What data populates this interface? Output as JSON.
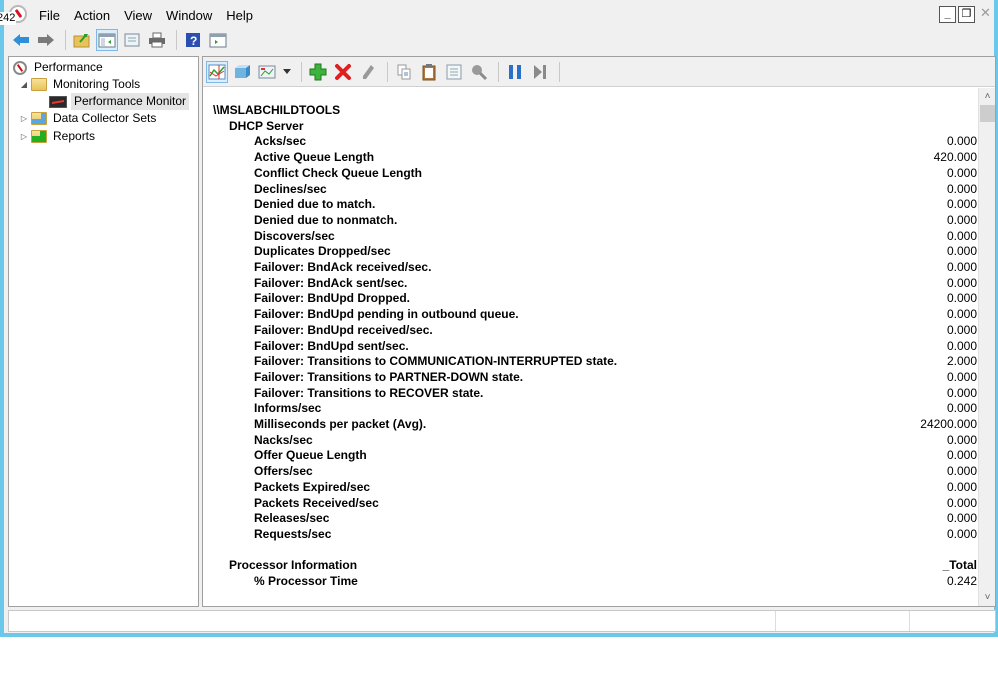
{
  "window": {
    "badge_text": "242",
    "menu": [
      "File",
      "Action",
      "View",
      "Window",
      "Help"
    ],
    "controls": {
      "minimize": "_",
      "restore": "❐",
      "close": "✕"
    }
  },
  "toolbar": {
    "buttons": [
      "back-icon",
      "forward-icon",
      "up-folder-icon",
      "show-hide-console-tree-icon",
      "properties-icon",
      "print-icon",
      "help-icon",
      "show-hide-action-pane-icon"
    ]
  },
  "tree": {
    "items": [
      {
        "label": "Performance",
        "level": 0,
        "expander": ""
      },
      {
        "label": "Monitoring Tools",
        "level": 1,
        "expander": "◢"
      },
      {
        "label": "Performance Monitor",
        "level": 2,
        "expander": "",
        "selected": true
      },
      {
        "label": "Data Collector Sets",
        "level": 1,
        "expander": "▷"
      },
      {
        "label": "Reports",
        "level": 1,
        "expander": "▷"
      }
    ]
  },
  "monitor_toolbar": {
    "buttons": [
      "view-current-activity-icon",
      "view-log-data-icon",
      "change-graph-type-icon",
      "dropdown-arrow-icon",
      "add-counter-icon",
      "delete-counter-icon",
      "highlight-icon",
      "copy-properties-icon",
      "paste-counter-list-icon",
      "properties-icon",
      "zoom-icon",
      "freeze-display-icon",
      "update-data-icon"
    ]
  },
  "report": {
    "machine": "\\\\MSLABCHILDTOOLS",
    "objects": [
      {
        "name": "DHCP Server",
        "instance": "",
        "counters": [
          {
            "name": "Acks/sec",
            "value": "0.000"
          },
          {
            "name": "Active Queue Length",
            "value": "420.000"
          },
          {
            "name": "Conflict Check Queue Length",
            "value": "0.000"
          },
          {
            "name": "Declines/sec",
            "value": "0.000"
          },
          {
            "name": "Denied due to match.",
            "value": "0.000"
          },
          {
            "name": "Denied due to nonmatch.",
            "value": "0.000"
          },
          {
            "name": "Discovers/sec",
            "value": "0.000"
          },
          {
            "name": "Duplicates Dropped/sec",
            "value": "0.000"
          },
          {
            "name": "Failover: BndAck received/sec.",
            "value": "0.000"
          },
          {
            "name": "Failover: BndAck sent/sec.",
            "value": "0.000"
          },
          {
            "name": "Failover: BndUpd Dropped.",
            "value": "0.000"
          },
          {
            "name": "Failover: BndUpd pending in outbound queue.",
            "value": "0.000"
          },
          {
            "name": "Failover: BndUpd received/sec.",
            "value": "0.000"
          },
          {
            "name": "Failover: BndUpd sent/sec.",
            "value": "0.000"
          },
          {
            "name": "Failover: Transitions to COMMUNICATION-INTERRUPTED state.",
            "value": "2.000"
          },
          {
            "name": "Failover: Transitions to PARTNER-DOWN state.",
            "value": "0.000"
          },
          {
            "name": "Failover: Transitions to RECOVER state.",
            "value": "0.000"
          },
          {
            "name": "Informs/sec",
            "value": "0.000"
          },
          {
            "name": "Milliseconds per packet (Avg).",
            "value": "24200.000"
          },
          {
            "name": "Nacks/sec",
            "value": "0.000"
          },
          {
            "name": "Offer Queue Length",
            "value": "0.000"
          },
          {
            "name": "Offers/sec",
            "value": "0.000"
          },
          {
            "name": "Packets Expired/sec",
            "value": "0.000"
          },
          {
            "name": "Packets Received/sec",
            "value": "0.000"
          },
          {
            "name": "Releases/sec",
            "value": "0.000"
          },
          {
            "name": "Requests/sec",
            "value": "0.000"
          }
        ]
      },
      {
        "name": "Processor Information",
        "instance": "_Total",
        "counters": [
          {
            "name": "% Processor Time",
            "value": "0.242"
          }
        ]
      }
    ]
  },
  "scrollbar": {
    "up": "˄",
    "down": "˅"
  }
}
